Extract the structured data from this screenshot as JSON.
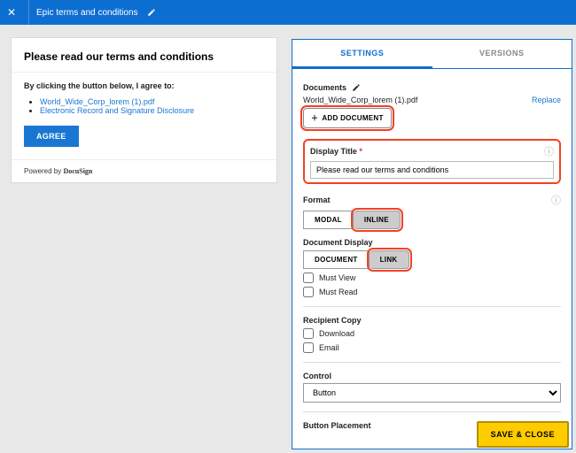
{
  "topbar": {
    "title": "Epic terms and conditions"
  },
  "card": {
    "heading": "Please read our terms and conditions",
    "intro": "By clicking the button below, I agree to:",
    "links": [
      "World_Wide_Corp_lorem (1).pdf",
      "Electronic Record and Signature Disclosure"
    ],
    "agree": "AGREE",
    "powered_prefix": "Powered by ",
    "powered_brand": "DocuSign"
  },
  "panel": {
    "tabs": {
      "settings": "SETTINGS",
      "versions": "VERSIONS"
    },
    "documents_label": "Documents",
    "doc_name": "World_Wide_Corp_lorem (1).pdf",
    "replace": "Replace",
    "add_doc": "ADD DOCUMENT",
    "display_title_label": "Display Title",
    "display_title_value": "Please read our terms and conditions",
    "format_label": "Format",
    "format_options": {
      "modal": "MODAL",
      "inline": "INLINE"
    },
    "doc_display_label": "Document Display",
    "doc_display_options": {
      "document": "DOCUMENT",
      "link": "LINK"
    },
    "must_view": "Must View",
    "must_read": "Must Read",
    "recipient_copy_label": "Recipient Copy",
    "download": "Download",
    "email": "Email",
    "control_label": "Control",
    "control_value": "Button",
    "button_placement_label": "Button Placement"
  },
  "footer": {
    "save_close": "SAVE & CLOSE"
  }
}
